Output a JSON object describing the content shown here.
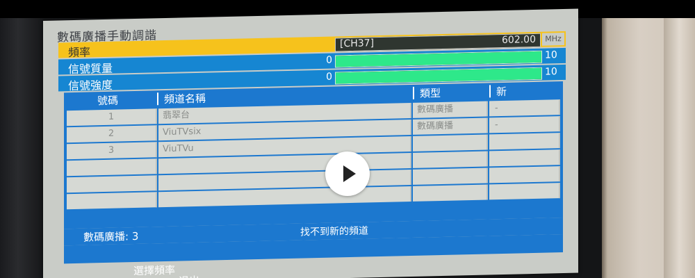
{
  "menu": {
    "title": "數碼廣播手動調諧",
    "frequency": {
      "label": "頻率",
      "channel": "[CH37]",
      "value": "602.00",
      "unit": "MHz"
    },
    "signal_quality": {
      "label": "信號質量",
      "min": "0",
      "max": "10",
      "level_fraction": 1.0
    },
    "signal_strength": {
      "label": "信號強度",
      "min": "0",
      "max": "10",
      "level_fraction": 1.0
    }
  },
  "table": {
    "headers": {
      "number": "號碼",
      "name": "頻道名稱",
      "type": "類型",
      "new": "新"
    },
    "rows": [
      {
        "number": "1",
        "name": "翡翠台",
        "type": "數碼廣播",
        "new": "-"
      },
      {
        "number": "2",
        "name": "ViuTVsix",
        "type": "數碼廣播",
        "new": "-"
      },
      {
        "number": "3",
        "name": "ViuTVu",
        "type": "",
        "new": ""
      },
      {
        "number": "",
        "name": "",
        "type": "",
        "new": ""
      },
      {
        "number": "",
        "name": "",
        "type": "",
        "new": ""
      },
      {
        "number": "",
        "name": "",
        "type": "",
        "new": ""
      }
    ]
  },
  "status": {
    "count": "數碼廣播:  3",
    "message": "找不到新的頻道"
  },
  "hints": {
    "select": "選擇頻率",
    "exit": "退出"
  },
  "player": {
    "icon": "play-icon"
  },
  "colors": {
    "highlight": "#f6c21c",
    "menu_blue": "#1686d2",
    "bar_green": "#2ee88a"
  }
}
